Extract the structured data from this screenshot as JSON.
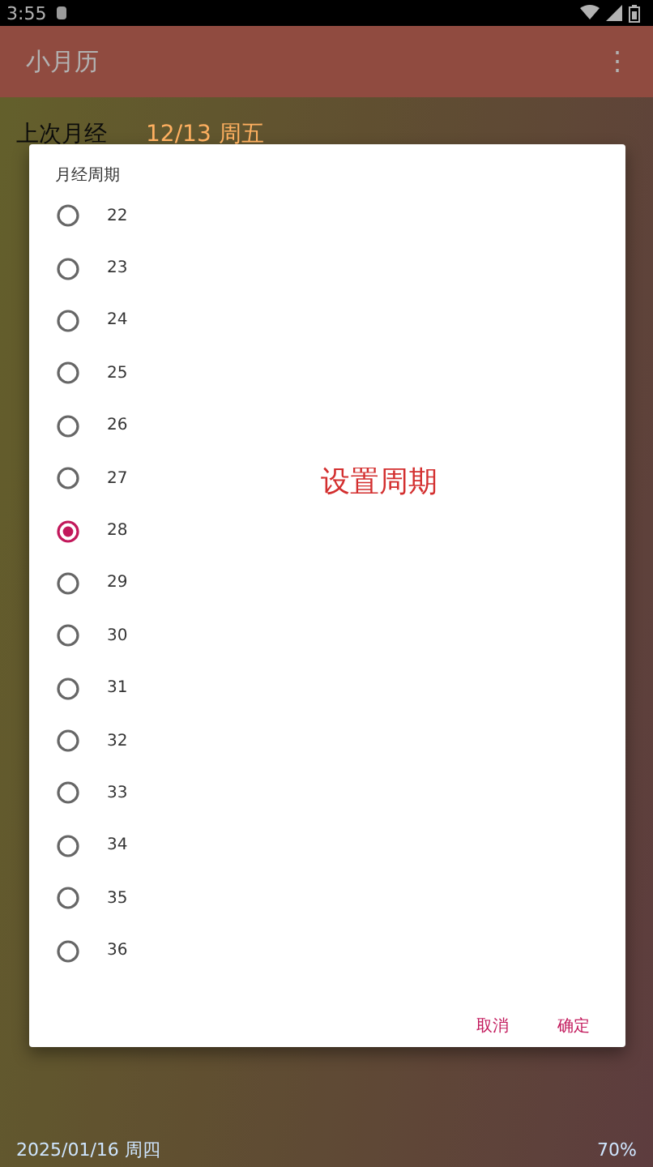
{
  "status_bar": {
    "time": "3:55"
  },
  "app_bar": {
    "title": "小月历",
    "menu": "⋮"
  },
  "background": {
    "last_period": {
      "label": "上次月经",
      "value": "12/13 周五"
    },
    "date": "2025/01/16  周四",
    "percent": "70%"
  },
  "dialog": {
    "title": "月经周期",
    "overlay_text": "设置周期",
    "options": [
      {
        "label": "22",
        "selected": false
      },
      {
        "label": "23",
        "selected": false
      },
      {
        "label": "24",
        "selected": false
      },
      {
        "label": "25",
        "selected": false
      },
      {
        "label": "26",
        "selected": false
      },
      {
        "label": "27",
        "selected": false
      },
      {
        "label": "28",
        "selected": true
      },
      {
        "label": "29",
        "selected": false
      },
      {
        "label": "30",
        "selected": false
      },
      {
        "label": "31",
        "selected": false
      },
      {
        "label": "32",
        "selected": false
      },
      {
        "label": "33",
        "selected": false
      },
      {
        "label": "34",
        "selected": false
      },
      {
        "label": "35",
        "selected": false
      },
      {
        "label": "36",
        "selected": false
      }
    ],
    "buttons": [
      "取消",
      "确定"
    ]
  }
}
